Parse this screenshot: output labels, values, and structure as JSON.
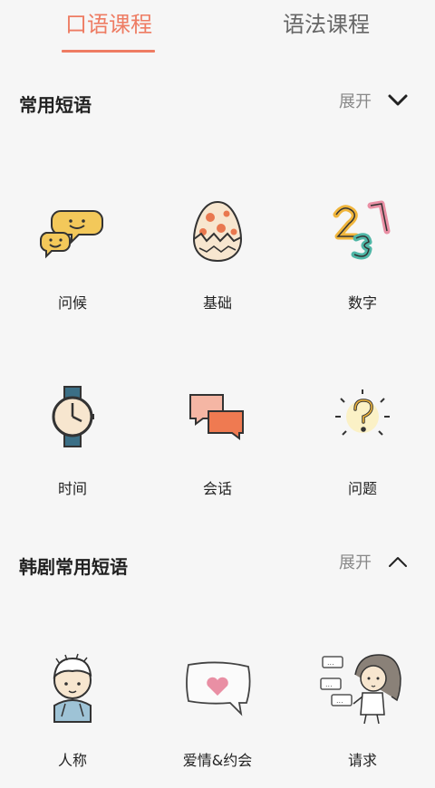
{
  "tabs": [
    {
      "label": "口语课程",
      "active": true
    },
    {
      "label": "语法课程",
      "active": false
    }
  ],
  "sections": [
    {
      "title": "常用短语",
      "expand_label": "展开",
      "items": [
        {
          "label": "问候",
          "icon": "speech-bubbles-smiley-icon"
        },
        {
          "label": "基础",
          "icon": "cracked-egg-icon"
        },
        {
          "label": "数字",
          "icon": "numbers-icon"
        },
        {
          "label": "时间",
          "icon": "wristwatch-icon"
        },
        {
          "label": "会话",
          "icon": "conversation-cards-icon"
        },
        {
          "label": "问题",
          "icon": "question-mark-icon"
        }
      ]
    },
    {
      "title": "韩剧常用短语",
      "expand_label": "展开",
      "items": [
        {
          "label": "人称",
          "icon": "person-hoodie-icon"
        },
        {
          "label": "爱情&约会",
          "icon": "heart-bubble-icon"
        },
        {
          "label": "请求",
          "icon": "girl-speech-bubbles-icon"
        }
      ]
    }
  ],
  "colors": {
    "accent": "#ee7c63",
    "background": "#f6f6f6"
  }
}
